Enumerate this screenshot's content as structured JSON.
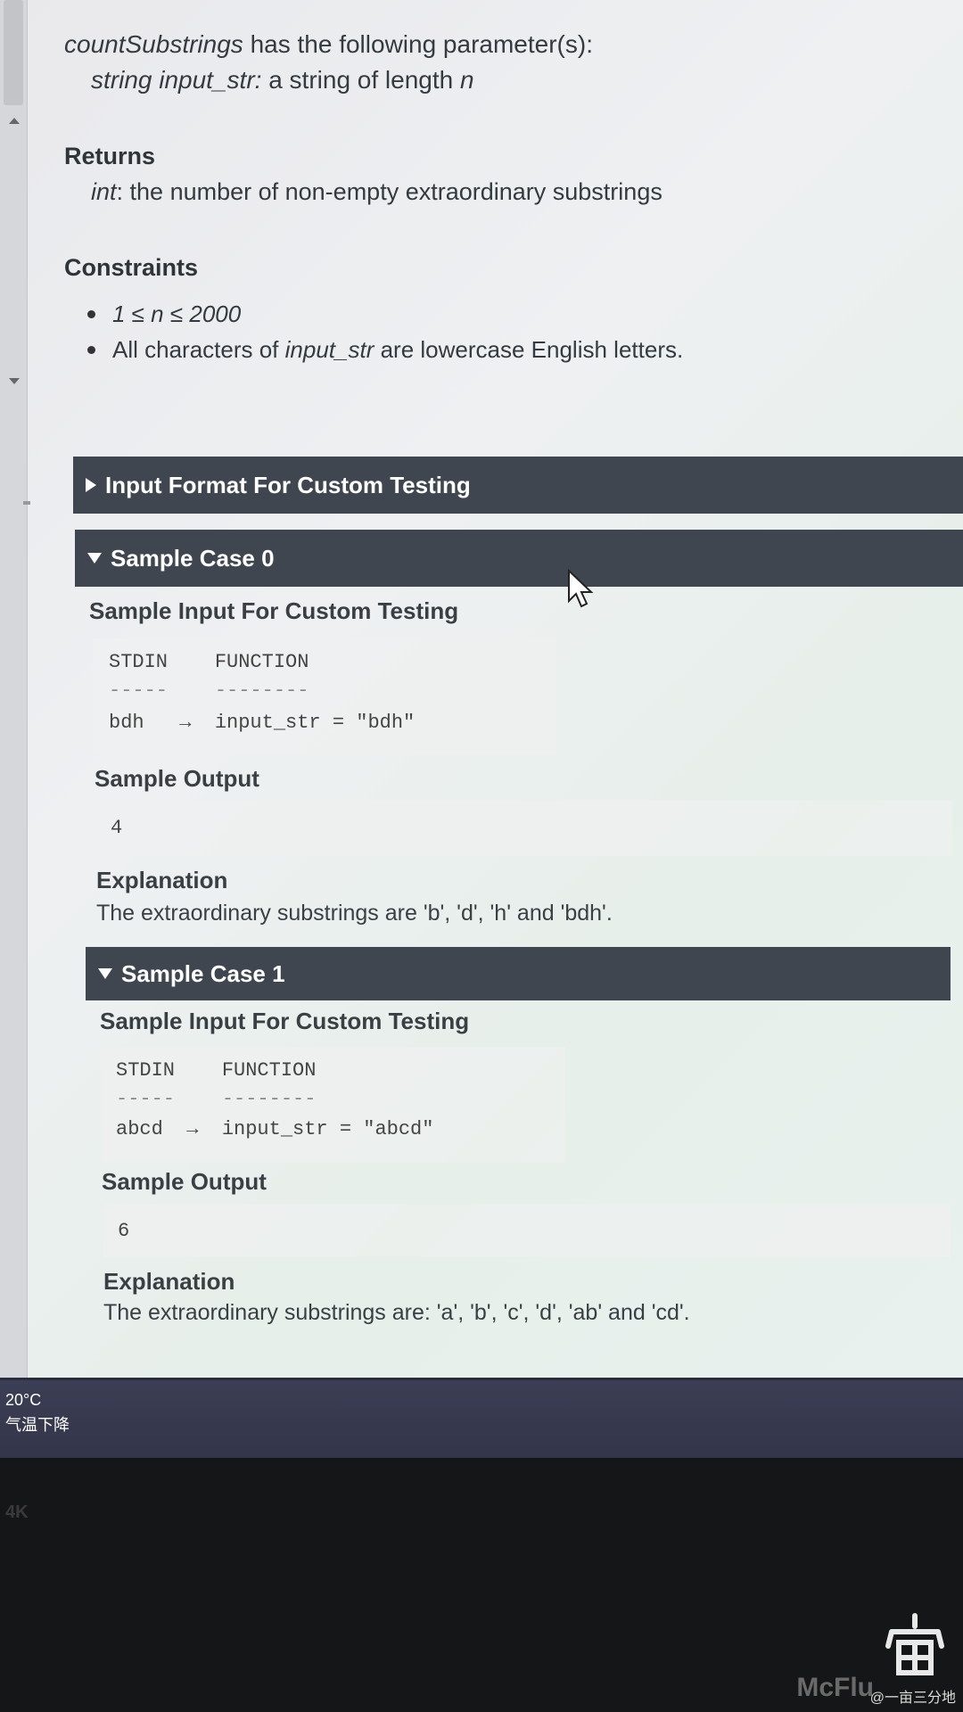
{
  "params": {
    "func_name": "countSubstrings",
    "heading_rest": " has the following parameter(s):",
    "param_type_name": "string input_str:",
    "param_desc": " a string of length ",
    "param_var": "n"
  },
  "returns": {
    "heading": "Returns",
    "type": "int",
    "desc": ": the number of non-empty extraordinary substrings"
  },
  "constraints": {
    "heading": "Constraints",
    "item1": "1 ≤ n ≤ 2000",
    "item2_pre": "All characters of ",
    "item2_var": "input_str",
    "item2_post": " are lowercase English letters."
  },
  "input_format_bar": "Input Format For Custom Testing",
  "case0": {
    "title": "Sample Case 0",
    "input_heading": "Sample Input For Custom Testing",
    "code": [
      "STDIN    FUNCTION",
      "-----    --------",
      "bdh   →  input_str = \"bdh\""
    ],
    "output_heading": "Sample Output",
    "output": "4",
    "explanation_heading": "Explanation",
    "explanation": "The extraordinary substrings are 'b', 'd', 'h' and 'bdh'."
  },
  "case1": {
    "title": "Sample Case 1",
    "input_heading": "Sample Input For Custom Testing",
    "code": [
      "STDIN    FUNCTION",
      "-----    --------",
      "abcd  →  input_str = \"abcd\""
    ],
    "output_heading": "Sample Output",
    "output": "6",
    "explanation_heading": "Explanation",
    "explanation": "The extraordinary substrings are: 'a', 'b', 'c', 'd', 'ab' and 'cd'."
  },
  "taskbar": {
    "temperature": "20°C",
    "condition": "气温下降"
  },
  "bezel": {
    "label": "4K",
    "brand": "McFlu"
  },
  "watermark": "@一亩三分地"
}
